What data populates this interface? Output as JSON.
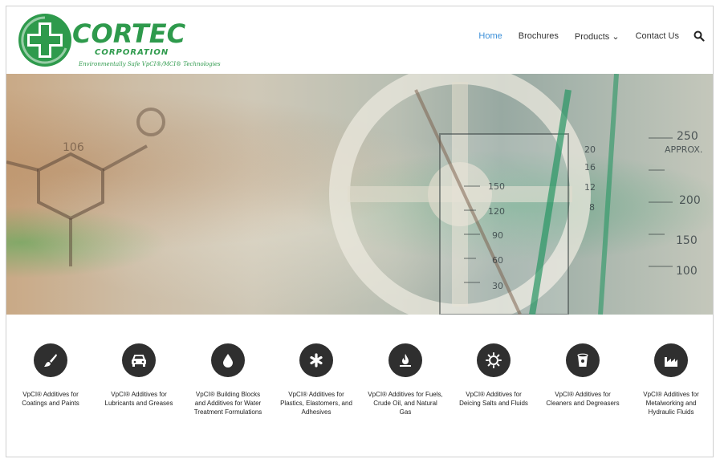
{
  "brand": {
    "name": "CORTEC",
    "subname": "CORPORATION",
    "tagline": "Environmentally Safe VpCI®/MCI® Technologies",
    "colors": {
      "logo_green": "#2e9a4c"
    }
  },
  "nav": {
    "items": [
      {
        "label": "Home",
        "active": true
      },
      {
        "label": "Brochures",
        "active": false
      },
      {
        "label": "Products ⌄",
        "active": false
      },
      {
        "label": "Contact Us",
        "active": false
      }
    ],
    "search_icon": "search-icon",
    "colors": {
      "active": "#3b8fd8",
      "default": "#333333"
    }
  },
  "hero": {
    "scale_labels": [
      "250",
      "APPROX.",
      "200",
      "150",
      "100",
      "150",
      "120",
      "90",
      "60",
      "30",
      "20",
      "16",
      "12",
      "8",
      "106"
    ]
  },
  "categories": [
    {
      "icon": "paintbrush-icon",
      "label": "VpCI® Additives for Coatings and Paints"
    },
    {
      "icon": "car-icon",
      "label": "VpCI® Additives for Lubricants and Greases"
    },
    {
      "icon": "water-drop-icon",
      "label": "VpCI® Building Blocks and Additives for Water Treatment Formulations"
    },
    {
      "icon": "asterisk-icon",
      "label": "VpCI® Additives for Plastics, Elastomers, and Adhesives"
    },
    {
      "icon": "fuel-flame-icon",
      "label": "VpCI® Additives for Fuels, Crude Oil, and Natural Gas"
    },
    {
      "icon": "sun-gear-icon",
      "label": "VpCI® Additives for Deicing Salts and Fluids"
    },
    {
      "icon": "bucket-icon",
      "label": "VpCI® Additives for Cleaners and Degreasers"
    },
    {
      "icon": "factory-icon",
      "label": "VpCI® Additives for Metalworking and Hydraulic Fluids"
    }
  ]
}
